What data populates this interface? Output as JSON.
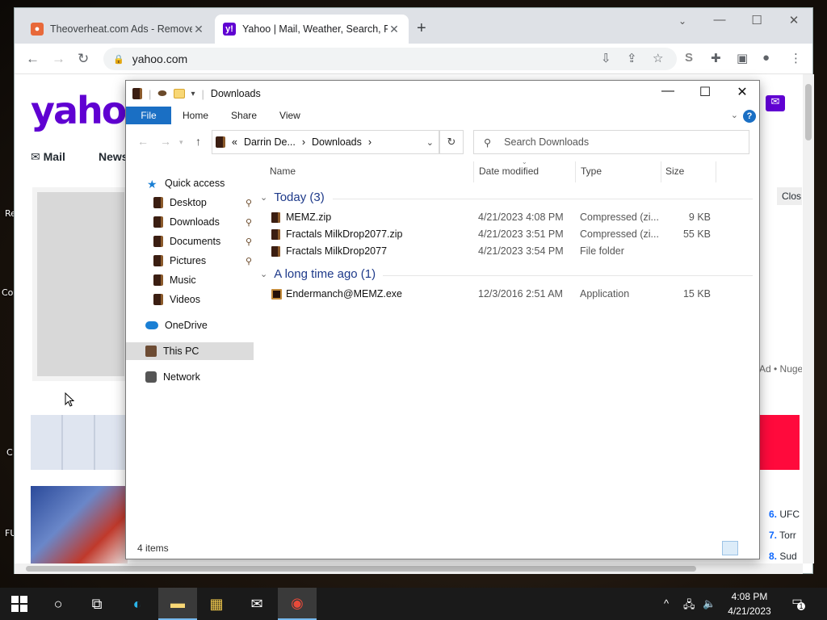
{
  "browser": {
    "tabs": [
      {
        "title": "Theoverheat.com Ads - Remove",
        "favicon_color": "#e8693a"
      },
      {
        "title": "Yahoo | Mail, Weather, Search, Po",
        "favicon_color": "#6001d2"
      }
    ],
    "url": "yahoo.com"
  },
  "yahoo_page": {
    "logo": "yahoo",
    "nav": [
      "Mail",
      "News"
    ],
    "close_label": "Clos",
    "ad_text": "Ad • Nuge",
    "trending": [
      {
        "num": "6.",
        "text": "UFC"
      },
      {
        "num": "7.",
        "text": "Torr"
      },
      {
        "num": "8.",
        "text": "Sud"
      }
    ]
  },
  "desktop_labels": [
    "Re",
    "Co",
    "C",
    "FU"
  ],
  "explorer": {
    "title": "Downloads",
    "ribbon_tabs": [
      "File",
      "Home",
      "Share",
      "View"
    ],
    "breadcrumb": [
      "Darrin De...",
      "Downloads"
    ],
    "breadcrumb_prefix": "«",
    "search_placeholder": "Search Downloads",
    "nav_pane": [
      {
        "label": "Quick access",
        "icon": "star-icon",
        "pinned": false
      },
      {
        "label": "Desktop",
        "icon": "folder-icon",
        "pinned": true
      },
      {
        "label": "Downloads",
        "icon": "folder-icon",
        "pinned": true
      },
      {
        "label": "Documents",
        "icon": "folder-icon",
        "pinned": true
      },
      {
        "label": "Pictures",
        "icon": "folder-icon",
        "pinned": true
      },
      {
        "label": "Music",
        "icon": "folder-icon",
        "pinned": false
      },
      {
        "label": "Videos",
        "icon": "folder-icon",
        "pinned": false
      },
      {
        "label": "OneDrive",
        "icon": "cloud-icon",
        "pinned": false
      },
      {
        "label": "This PC",
        "icon": "computer-icon",
        "pinned": false
      },
      {
        "label": "Network",
        "icon": "network-icon",
        "pinned": false
      }
    ],
    "columns": [
      "Name",
      "Date modified",
      "Type",
      "Size"
    ],
    "groups": [
      {
        "label": "Today (3)",
        "files": [
          {
            "name": "MEMZ.zip",
            "date": "4/21/2023 4:08 PM",
            "type": "Compressed (zi...",
            "size": "9 KB"
          },
          {
            "name": "Fractals MilkDrop2077.zip",
            "date": "4/21/2023 3:51 PM",
            "type": "Compressed (zi...",
            "size": "55 KB"
          },
          {
            "name": "Fractals MilkDrop2077",
            "date": "4/21/2023 3:54 PM",
            "type": "File folder",
            "size": ""
          }
        ]
      },
      {
        "label": "A long time ago (1)",
        "files": [
          {
            "name": "Endermanch@MEMZ.exe",
            "date": "12/3/2016 2:51 AM",
            "type": "Application",
            "size": "15 KB"
          }
        ]
      }
    ],
    "status": "4 items"
  },
  "taskbar": {
    "time": "4:08 PM",
    "date": "4/21/2023",
    "notification_count": "1"
  }
}
